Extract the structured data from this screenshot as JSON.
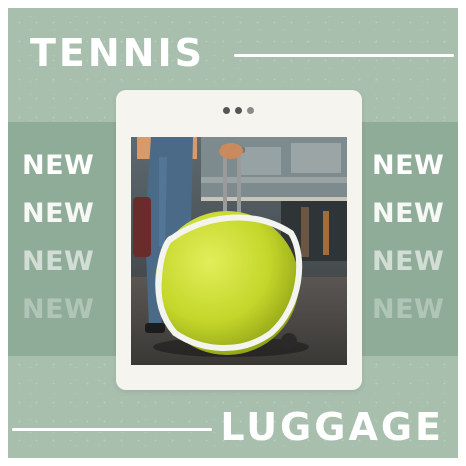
{
  "poster": {
    "title": "TENNIS",
    "subtitle": "LUGGAGE",
    "left_column": [
      "NEW",
      "NEW",
      "NEW",
      "NEW"
    ],
    "right_column": [
      "NEW",
      "NEW",
      "NEW",
      "NEW"
    ]
  },
  "photo": {
    "subject": "tennis-ball-luggage"
  },
  "colors": {
    "background": "#a8bfae",
    "band": "#8fac98",
    "text": "#ffffff",
    "card": "#f6f4ee",
    "ball": "#c8dc2a"
  }
}
